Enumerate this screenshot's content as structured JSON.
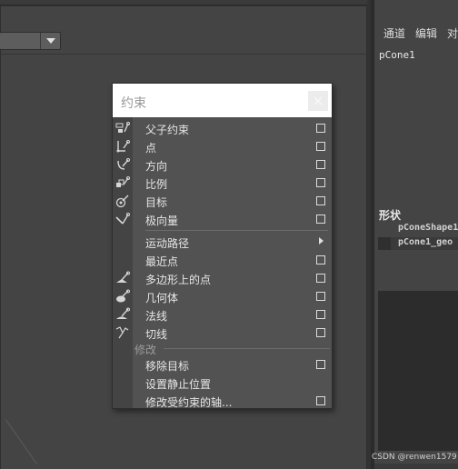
{
  "viewport": {},
  "channel_box": {
    "menu": [
      "通道",
      "编辑",
      "对"
    ],
    "object_name": "pCone1",
    "shapes_title": "形状",
    "shapes": [
      "pConeShape1",
      "pCone1_geo"
    ]
  },
  "watermark": "CSDN @renwen1579",
  "constrain_menu": {
    "title": "约束",
    "group1": [
      {
        "label": "父子约束",
        "icon": "parent-constraint-icon"
      },
      {
        "label": "点",
        "icon": "point-constraint-icon"
      },
      {
        "label": "方向",
        "icon": "orient-constraint-icon"
      },
      {
        "label": "比例",
        "icon": "scale-constraint-icon"
      },
      {
        "label": "目标",
        "icon": "aim-constraint-icon"
      },
      {
        "label": "极向量",
        "icon": "pole-vector-icon"
      }
    ],
    "group2": [
      {
        "label": "运动路径",
        "submenu": true
      },
      {
        "label": "最近点"
      },
      {
        "label": "多边形上的点",
        "icon": "point-on-poly-icon"
      },
      {
        "label": "几何体",
        "icon": "geometry-constraint-icon"
      },
      {
        "label": "法线",
        "icon": "normal-constraint-icon"
      },
      {
        "label": "切线",
        "icon": "tangent-constraint-icon"
      }
    ],
    "section_label": "修改",
    "group3": [
      {
        "label": "移除目标"
      },
      {
        "label": "设置静止位置"
      },
      {
        "label": "修改受约束的轴..."
      }
    ]
  },
  "colors": {
    "menu_bg": "#525252",
    "header_bg": "#ffffff",
    "icon_accent": "#d6d6d6"
  }
}
